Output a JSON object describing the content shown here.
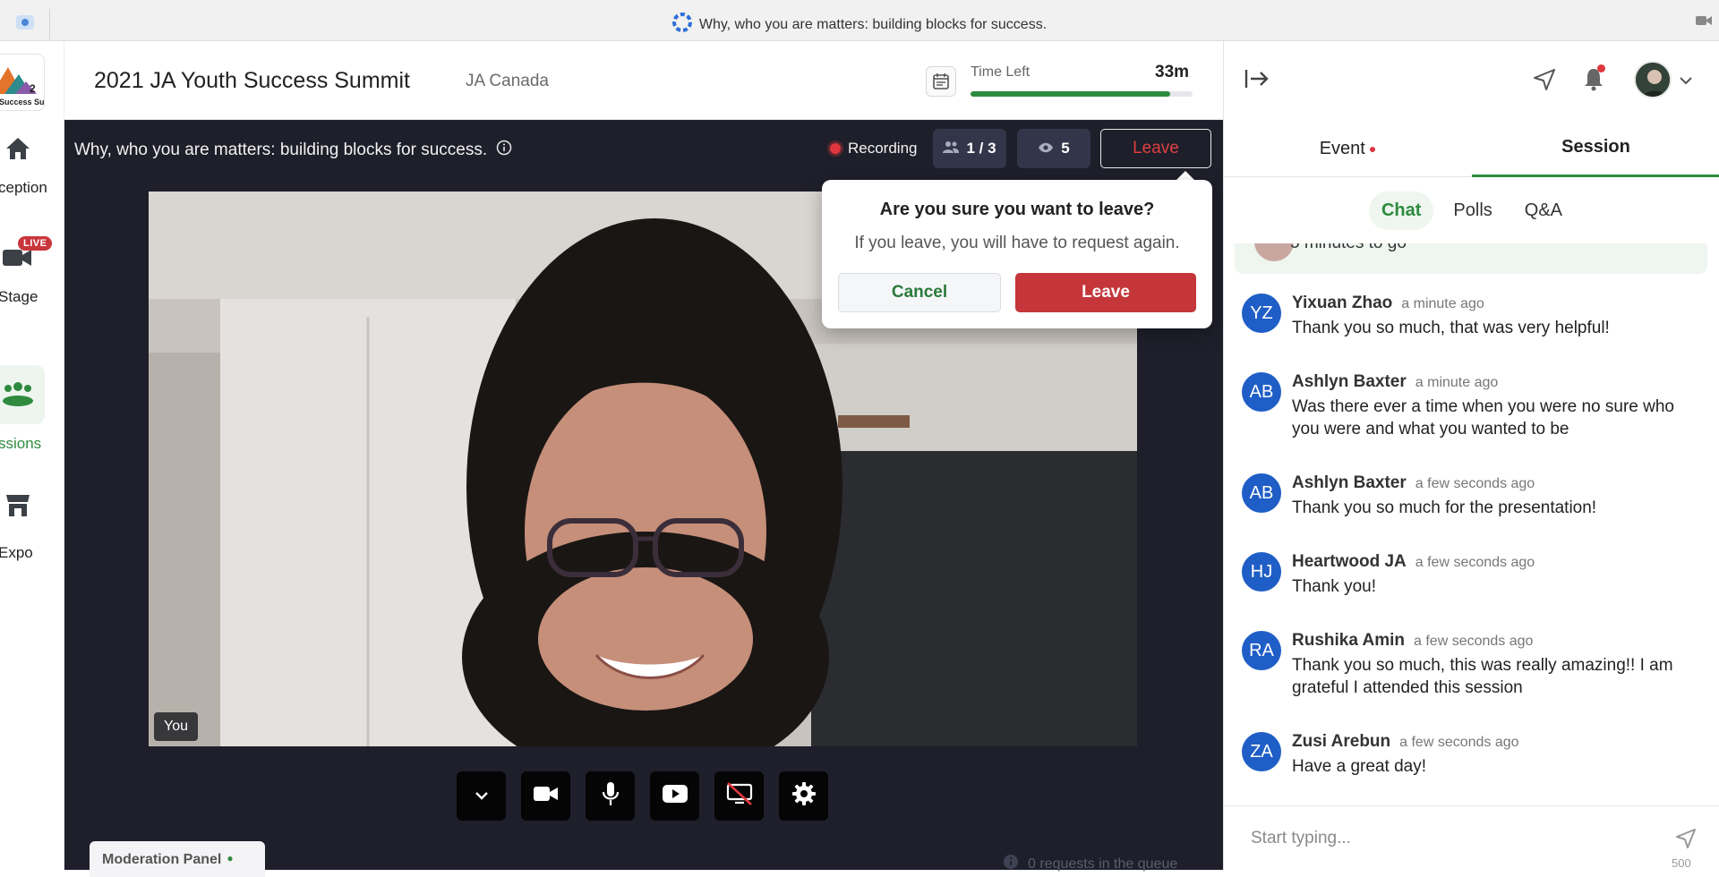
{
  "browser": {
    "title": "Why, who you are matters: building blocks for success."
  },
  "nav": {
    "logo_text": "Success Su",
    "items": [
      {
        "label": "ception",
        "icon": "home-icon"
      },
      {
        "label": "Stage",
        "icon": "video-camera-icon",
        "badge": "LIVE"
      },
      {
        "label": "ssions",
        "icon": "people-group-icon",
        "active": true
      },
      {
        "label": "Expo",
        "icon": "storefront-icon"
      }
    ]
  },
  "header": {
    "event_title": "2021 JA Youth Success Summit",
    "org_name": "JA Canada",
    "time_left_label": "Time Left",
    "time_left_value": "33m",
    "time_left_progress": 0.9
  },
  "stage": {
    "session_title": "Why, who you are matters: building blocks for success.",
    "recording_label": "Recording",
    "participants": "1 / 3",
    "viewers": "5",
    "leave_label": "Leave",
    "you_label": "You",
    "moderation_label": "Moderation Panel",
    "queue_text": "0 requests in the queue"
  },
  "popover": {
    "title": "Are you sure you want to leave?",
    "body": "If you leave, you will have to request again.",
    "cancel": "Cancel",
    "leave": "Leave"
  },
  "panel": {
    "tabs": [
      {
        "label": "Event",
        "dot": true
      },
      {
        "label": "Session",
        "active": true
      }
    ],
    "subtabs": [
      {
        "label": "Chat",
        "active": true
      },
      {
        "label": "Polls"
      },
      {
        "label": "Q&A"
      }
    ],
    "prev_message_fragment": "5 minutes to go",
    "messages": [
      {
        "initials": "YZ",
        "name": "Yixuan Zhao",
        "time": "a minute ago",
        "text": "Thank you so much, that was very helpful!"
      },
      {
        "initials": "AB",
        "name": "Ashlyn Baxter",
        "time": "a minute ago",
        "text": "Was there ever a time when you were no sure who you were and what you wanted to be"
      },
      {
        "initials": "AB",
        "name": "Ashlyn Baxter",
        "time": "a few seconds ago",
        "text": "Thank you so much for the presentation!"
      },
      {
        "initials": "HJ",
        "name": "Heartwood JA",
        "time": "a few seconds ago",
        "text": "Thank you!"
      },
      {
        "initials": "RA",
        "name": "Rushika Amin",
        "time": "a few seconds ago",
        "text": "Thank you so much, this was really amazing!! I am grateful I attended this session"
      },
      {
        "initials": "ZA",
        "name": "Zusi Arebun",
        "time": "a few seconds ago",
        "text": "Have a great day!"
      }
    ],
    "composer_placeholder": "Start typing...",
    "char_counter": "500"
  },
  "colors": {
    "accent_green": "#2e8b3e",
    "danger_red": "#c4363a",
    "stage_bg": "#1e1f2a",
    "avatar_blue": "#1f5ec6"
  }
}
